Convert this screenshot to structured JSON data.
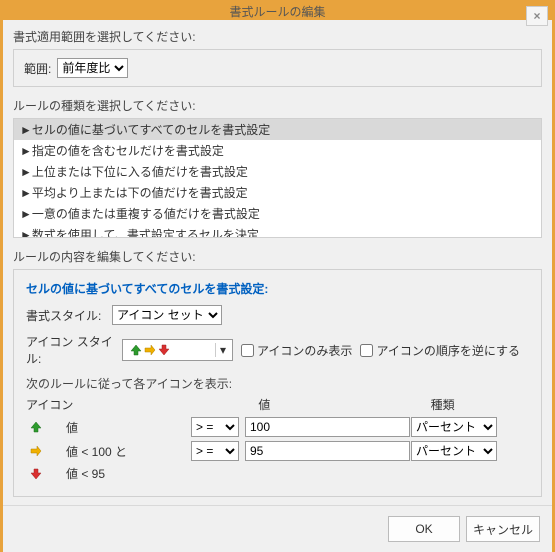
{
  "title": "書式ルールの編集",
  "close_glyph": "×",
  "scope": {
    "label": "書式適用範囲を選択してください:",
    "range_label": "範囲:",
    "range_value": "前年度比"
  },
  "ruletype": {
    "label": "ルールの種類を選択してください:",
    "items": [
      "►セルの値に基づいてすべてのセルを書式設定",
      "►指定の値を含むセルだけを書式設定",
      "►上位または下位に入る値だけを書式設定",
      "►平均より上または下の値だけを書式設定",
      "►一意の値または重複する値だけを書式設定",
      "►数式を使用して、書式設定するセルを決定"
    ]
  },
  "content": {
    "label": "ルールの内容を編集してください:",
    "title": "セルの値に基づいてすべてのセルを書式設定:",
    "style_label": "書式スタイル:",
    "style_value": "アイコン セット",
    "iconstyle_label": "アイコン スタイル:",
    "iconsonly_label": "アイコンのみ表示",
    "reverse_label": "アイコンの順序を逆にする",
    "rulesdesc": "次のルールに従って各アイコンを表示:",
    "head_icon": "アイコン",
    "head_value": "値",
    "head_type": "種類",
    "op_ge": "> =",
    "type_percent": "パーセント",
    "rows": [
      {
        "desc": "値",
        "value": "100"
      },
      {
        "desc": "値 < 100 と",
        "value": "95"
      },
      {
        "desc": "値 < 95"
      }
    ]
  },
  "footer": {
    "ok": "OK",
    "cancel": "キャンセル"
  },
  "colors": {
    "green": "#2e9b2e",
    "yellow": "#f0b000",
    "red": "#d93030"
  }
}
